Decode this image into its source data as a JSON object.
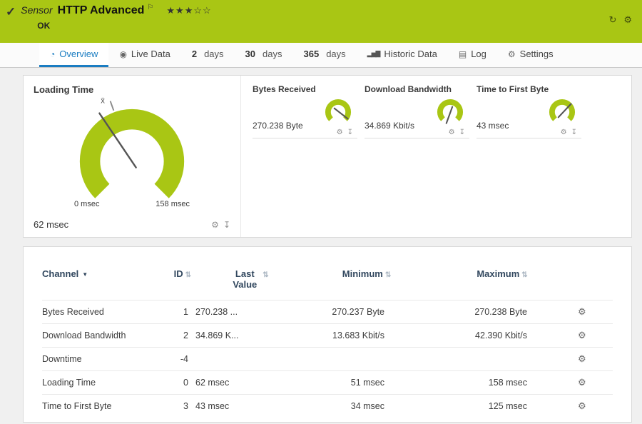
{
  "icons": {
    "check": "✓",
    "flag": "⚐",
    "gear": "⚙",
    "pin": "↧",
    "refresh": "↻",
    "sort": "⇅",
    "dropdown": "▼",
    "overview": "◔",
    "live": "◉",
    "chart_bars": "▂▅▇",
    "log": "▤"
  },
  "header": {
    "kind": "Sensor",
    "title": "HTTP Advanced",
    "stars": "★★★☆☆",
    "status": "OK"
  },
  "tabs": {
    "overview": "Overview",
    "live": "Live Data",
    "d2": "2",
    "d30": "30",
    "d365": "365",
    "days": "days",
    "historic": "Historic Data",
    "log": "Log",
    "settings": "Settings"
  },
  "gauge_panel": {
    "main": {
      "title": "Loading Time",
      "value": "62 msec",
      "scale_min": "0 msec",
      "scale_max": "158 msec",
      "avg_marker": "x̄"
    },
    "minis": [
      {
        "title": "Bytes Received",
        "value": "270.238 Byte"
      },
      {
        "title": "Download Bandwidth",
        "value": "34.869 Kbit/s"
      },
      {
        "title": "Time to First Byte",
        "value": "43 msec"
      }
    ]
  },
  "table": {
    "headers": {
      "channel": "Channel",
      "id": "ID",
      "last_value": "Last Value",
      "minimum": "Minimum",
      "maximum": "Maximum"
    },
    "rows": [
      {
        "channel": "Bytes Received",
        "id": "1",
        "last": "270.238 ...",
        "min": "270.237 Byte",
        "max": "270.238 Byte"
      },
      {
        "channel": "Download Bandwidth",
        "id": "2",
        "last": "34.869 K...",
        "min": "13.683 Kbit/s",
        "max": "42.390 Kbit/s"
      },
      {
        "channel": "Downtime",
        "id": "-4",
        "last": "",
        "min": "",
        "max": ""
      },
      {
        "channel": "Loading Time",
        "id": "0",
        "last": "62 msec",
        "min": "51 msec",
        "max": "158 msec"
      },
      {
        "channel": "Time to First Byte",
        "id": "3",
        "last": "43 msec",
        "min": "34 msec",
        "max": "125 msec"
      }
    ]
  },
  "colors": {
    "status_green": "#a9c614",
    "accent_blue": "#1b7dc2",
    "table_header_navy": "#31475e"
  }
}
